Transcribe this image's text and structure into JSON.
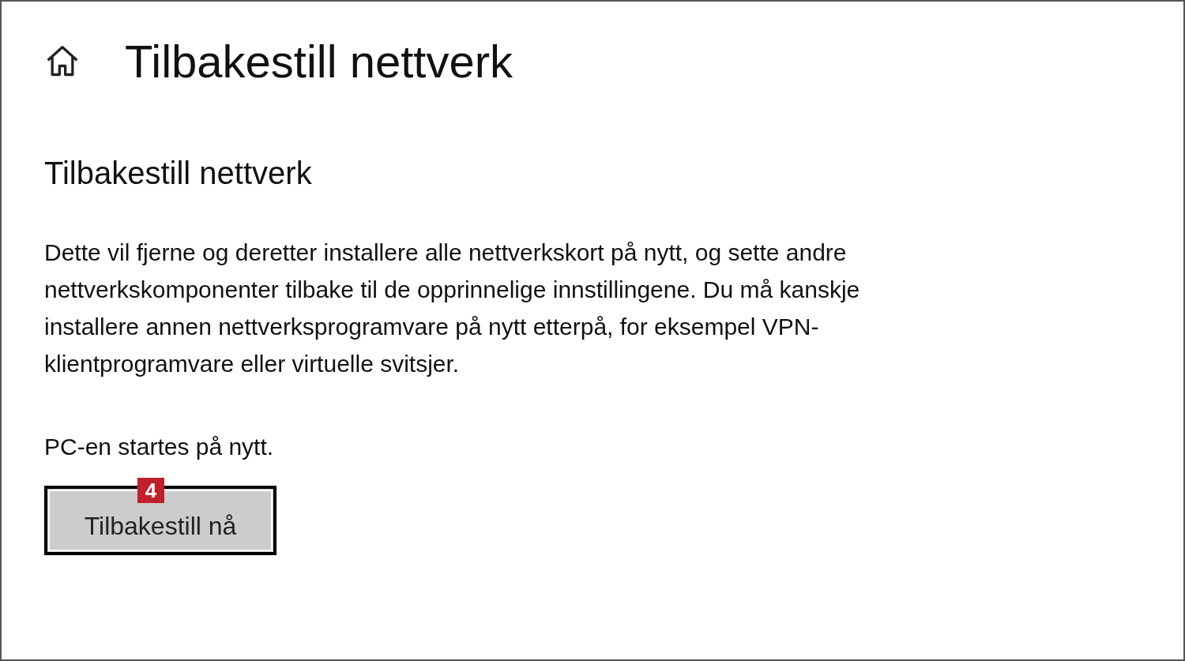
{
  "page": {
    "title": "Tilbakestill nettverk"
  },
  "section": {
    "heading": "Tilbakestill nettverk",
    "description": "Dette vil fjerne og deretter installere alle nettverkskort på nytt, og sette andre nettverkskomponenter tilbake til de opprinnelige innstillingene. Du må kanskje installere annen nettverksprogramvare på nytt etterpå, for eksempel VPN-klientprogramvare eller virtuelle svitsjer.",
    "note": "PC-en startes på nytt.",
    "button": {
      "label": "Tilbakestill nå",
      "callout": "4"
    }
  }
}
